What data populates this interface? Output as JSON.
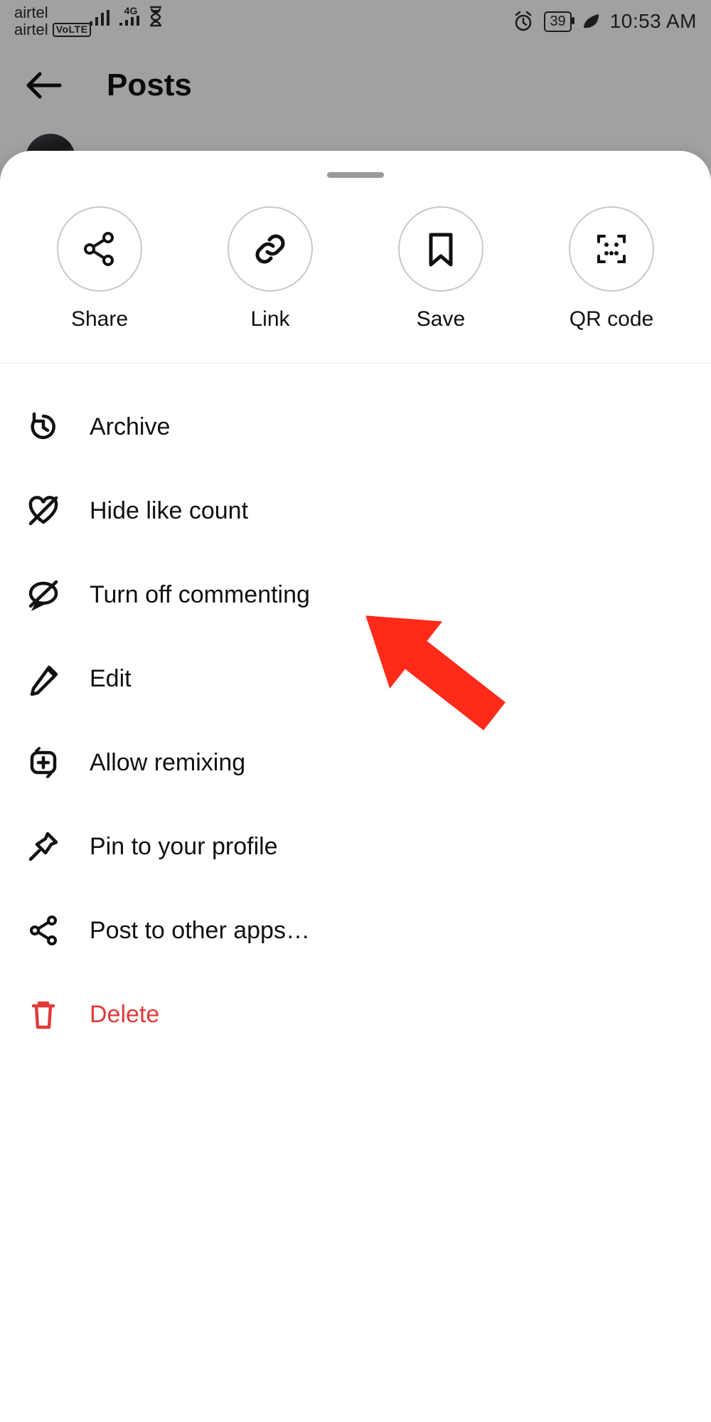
{
  "status": {
    "carrier1": "airtel",
    "carrier2": "airtel",
    "volte": "VoLTE",
    "net_label": "4G",
    "battery": "39",
    "time": "10:53 AM"
  },
  "header": {
    "title": "Posts"
  },
  "quick": {
    "share": "Share",
    "link": "Link",
    "save": "Save",
    "qr": "QR code"
  },
  "menu": {
    "archive": "Archive",
    "hide_likes": "Hide like count",
    "turn_off_comment": "Turn off commenting",
    "edit": "Edit",
    "allow_remix": "Allow remixing",
    "pin": "Pin to your profile",
    "post_other": "Post to other apps…",
    "delete": "Delete"
  },
  "annotation": {
    "color": "#ff2a1a"
  }
}
